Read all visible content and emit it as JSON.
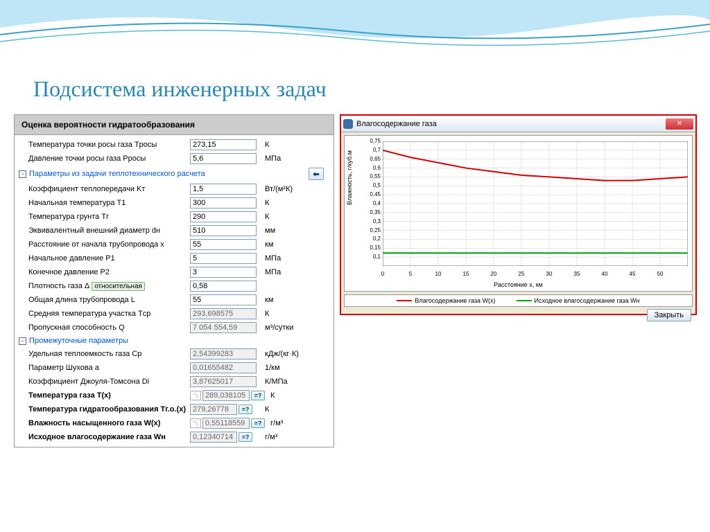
{
  "slide": {
    "title": "Подсистема инженерных задач"
  },
  "form": {
    "header": "Оценка вероятности гидратообразования",
    "rows": [
      {
        "label": "Температура точки росы газа Tросы",
        "value": "273,15",
        "unit": "К"
      },
      {
        "label": "Давление точки росы газа Pросы",
        "value": "5,6",
        "unit": "МПа"
      }
    ],
    "section1": {
      "title": "Параметры из задачи теплотехнического расчета",
      "rows": [
        {
          "label": "Коэффициент теплопередачи Kт",
          "value": "1,5",
          "unit": "Вт/(м²К)"
        },
        {
          "label": "Начальная температура T1",
          "value": "300",
          "unit": "К"
        },
        {
          "label": "Температура грунта Tг",
          "value": "290",
          "unit": "К"
        },
        {
          "label": "Эквивалентный внешний диаметр dн",
          "value": "510",
          "unit": "мм"
        },
        {
          "label": "Расстояние от начала трубопровода x",
          "value": "55",
          "unit": "км"
        },
        {
          "label": "Начальное давление P1",
          "value": "5",
          "unit": "МПа"
        },
        {
          "label": "Конечное давление P2",
          "value": "3",
          "unit": "МПа"
        },
        {
          "label_base": "Плотность газа Δ",
          "tag": "относительная",
          "value": "0,58",
          "unit": ""
        },
        {
          "label": "Общая длина трубопровода L",
          "value": "55",
          "unit": "км"
        },
        {
          "label": "Средняя температура участка Tср",
          "value": "293,698575",
          "unit": "К",
          "readonly": true
        },
        {
          "label": "Пропускная способность Q",
          "value": "7 054 554,59",
          "unit": "м³/сутки",
          "readonly": true
        }
      ]
    },
    "section2": {
      "title": "Промежуточные параметры",
      "rows": [
        {
          "label": "Удельная теплоемкость газа Cp",
          "value": "2,54399283",
          "unit": "кДж/(кг·К)",
          "readonly": true
        },
        {
          "label": "Параметр Шухова a",
          "value": "0,01655482",
          "unit": "1/км",
          "readonly": true
        },
        {
          "label": "Коэффициент Джоуля-Томсона Di",
          "value": "3,87625017",
          "unit": "К/МПа",
          "readonly": true
        }
      ]
    },
    "results": [
      {
        "label": "Температура газа T(x)",
        "value": "289,038105",
        "unit": "К",
        "chart": true
      },
      {
        "label": "Температура гидратообразования Tг.о.(x)",
        "value": "279,26778",
        "unit": "К"
      },
      {
        "label": "Влажность насыщенного газа W(x)",
        "value": "0,55118559",
        "unit": "г/м³",
        "chart": true
      },
      {
        "label": "Исходное влагосодержание газа Wн",
        "value": "0,12340714",
        "unit": "г/м³"
      }
    ],
    "help_label": "=?"
  },
  "dialog": {
    "title": "Влагосодержание газа",
    "close_btn": "Закрыть",
    "legend1": "Влагосодержание газа W(x)",
    "legend2": "Исходное влагосодержание газа Wн",
    "xlabel": "Расстояние x, км",
    "ylabel": "Влажность, г/куб.м"
  },
  "chart_data": {
    "type": "line",
    "xlabel": "Расстояние x, км",
    "ylabel": "Влажность, г/куб.м",
    "xlim": [
      0,
      55
    ],
    "ylim": [
      0.05,
      0.75
    ],
    "x_ticks": [
      0,
      5,
      10,
      15,
      20,
      25,
      30,
      35,
      40,
      45,
      50
    ],
    "y_ticks": [
      0.1,
      0.15,
      0.2,
      0.25,
      0.3,
      0.35,
      0.4,
      0.45,
      0.5,
      0.55,
      0.6,
      0.65,
      0.7,
      0.75
    ],
    "series": [
      {
        "name": "Влагосодержание газа W(x)",
        "color": "#d20000",
        "x": [
          0,
          5,
          10,
          15,
          20,
          25,
          30,
          35,
          40,
          45,
          50,
          55
        ],
        "y": [
          0.7,
          0.66,
          0.63,
          0.6,
          0.58,
          0.56,
          0.55,
          0.54,
          0.53,
          0.53,
          0.54,
          0.55
        ]
      },
      {
        "name": "Исходное влагосодержание газа Wн",
        "color": "#00a000",
        "x": [
          0,
          55
        ],
        "y": [
          0.123,
          0.123
        ]
      }
    ]
  }
}
